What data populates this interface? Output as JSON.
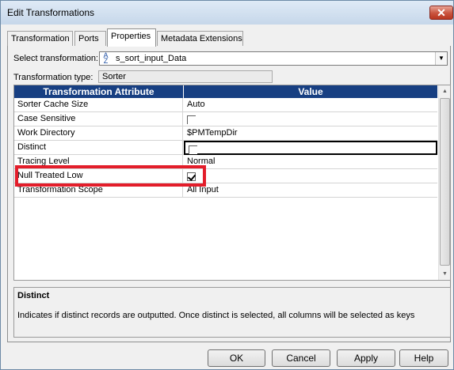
{
  "window": {
    "title": "Edit Transformations",
    "close_label": "✕"
  },
  "tabs": [
    {
      "label": "Transformation"
    },
    {
      "label": "Ports"
    },
    {
      "label": "Properties"
    },
    {
      "label": "Metadata Extensions"
    }
  ],
  "select_transformation": {
    "label": "Select transformation:",
    "value": "s_sort_input_Data",
    "icon": "sort-az-icon"
  },
  "transformation_type": {
    "label": "Transformation type:",
    "value": "Sorter"
  },
  "grid": {
    "headers": [
      "Transformation Attribute",
      "Value"
    ],
    "rows": [
      {
        "attribute": "Sorter Cache Size",
        "value": "Auto"
      },
      {
        "attribute": "Case Sensitive",
        "checked": false
      },
      {
        "attribute": "Work Directory",
        "value": "$PMTempDir"
      },
      {
        "attribute": "Distinct",
        "checked": false
      },
      {
        "attribute": "Tracing Level",
        "value": "Normal"
      },
      {
        "attribute": "Null Treated Low",
        "checked": true
      },
      {
        "attribute": "Transformation Scope",
        "value": "All Input"
      }
    ],
    "highlight_color": "#e31d2a",
    "header_color": "#173f82"
  },
  "description": {
    "title": "Distinct",
    "text": "Indicates if distinct records are outputted. Once distinct is selected, all columns will be selected as keys"
  },
  "buttons": {
    "ok": "OK",
    "cancel": "Cancel",
    "apply": "Apply",
    "help": "Help"
  }
}
